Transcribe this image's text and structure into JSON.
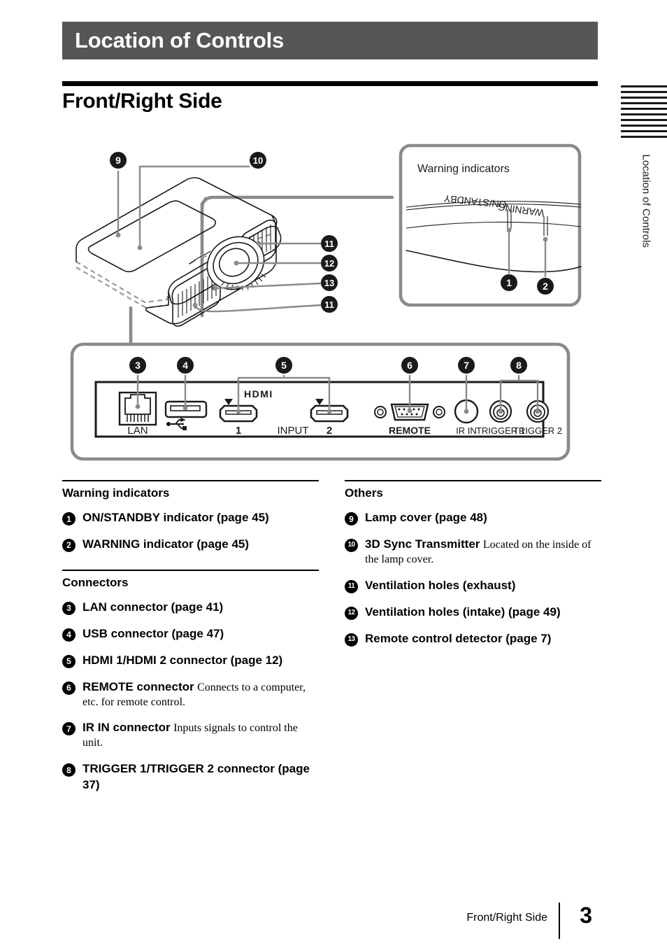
{
  "chapter": {
    "title": "Location of Controls"
  },
  "section": {
    "title": "Front/Right Side"
  },
  "thumb_tab": {
    "text": "Location of Controls",
    "stripe_count": 10
  },
  "figure": {
    "callout_box_title": "Warning indicators",
    "warning_labels": {
      "on_standby": "ON/STANDBY",
      "warning": "WARNING"
    },
    "projector_callouts": [
      "9",
      "10",
      "11",
      "12",
      "13",
      "11"
    ],
    "panel_callouts": [
      "3",
      "4",
      "5",
      "6",
      "7",
      "8"
    ],
    "indicator_callouts": [
      "1",
      "2"
    ],
    "panel_labels": {
      "lan": "LAN",
      "hdmi_logo": "HDMI",
      "hdmi_1": "1",
      "input": "INPUT",
      "hdmi_2": "2",
      "remote": "REMOTE",
      "ir_in": "IR IN",
      "trigger_1": "TRIGGER 1",
      "trigger_2": "TRIGGER 2"
    },
    "colors": {
      "leader_gray": "#8a8a8a",
      "line_black": "#1a1a1a",
      "header_gray": "#565656"
    }
  },
  "groups": {
    "warning_indicators": {
      "heading": "Warning indicators",
      "items": [
        {
          "num": "1",
          "title": "ON/STANDBY indicator (page 45)",
          "desc": ""
        },
        {
          "num": "2",
          "title": "WARNING indicator (page 45)",
          "desc": ""
        }
      ]
    },
    "connectors": {
      "heading": "Connectors",
      "items": [
        {
          "num": "3",
          "title": "LAN connector (page 41)",
          "desc": ""
        },
        {
          "num": "4",
          "title": "USB connector (page 47)",
          "desc": ""
        },
        {
          "num": "5",
          "title": "HDMI 1/HDMI 2 connector (page 12)",
          "desc": ""
        },
        {
          "num": "6",
          "title": "REMOTE connector",
          "desc": "Connects to a computer, etc. for remote control."
        },
        {
          "num": "7",
          "title": "IR IN connector",
          "desc": "Inputs signals to control the unit."
        },
        {
          "num": "8",
          "title": "TRIGGER 1/TRIGGER 2 connector (page 37)",
          "desc": ""
        }
      ]
    },
    "others": {
      "heading": "Others",
      "items": [
        {
          "num": "9",
          "title": "Lamp cover (page 48)",
          "desc": ""
        },
        {
          "num": "10",
          "title": "3D Sync Transmitter",
          "desc": "Located on the inside of the lamp cover."
        },
        {
          "num": "11",
          "title": "Ventilation holes (exhaust)",
          "desc": ""
        },
        {
          "num": "12",
          "title": "Ventilation holes (intake) (page 49)",
          "desc": ""
        },
        {
          "num": "13",
          "title": "Remote control detector (page 7)",
          "desc": ""
        }
      ]
    }
  },
  "footer": {
    "label": "Front/Right Side",
    "page_number": "3"
  }
}
